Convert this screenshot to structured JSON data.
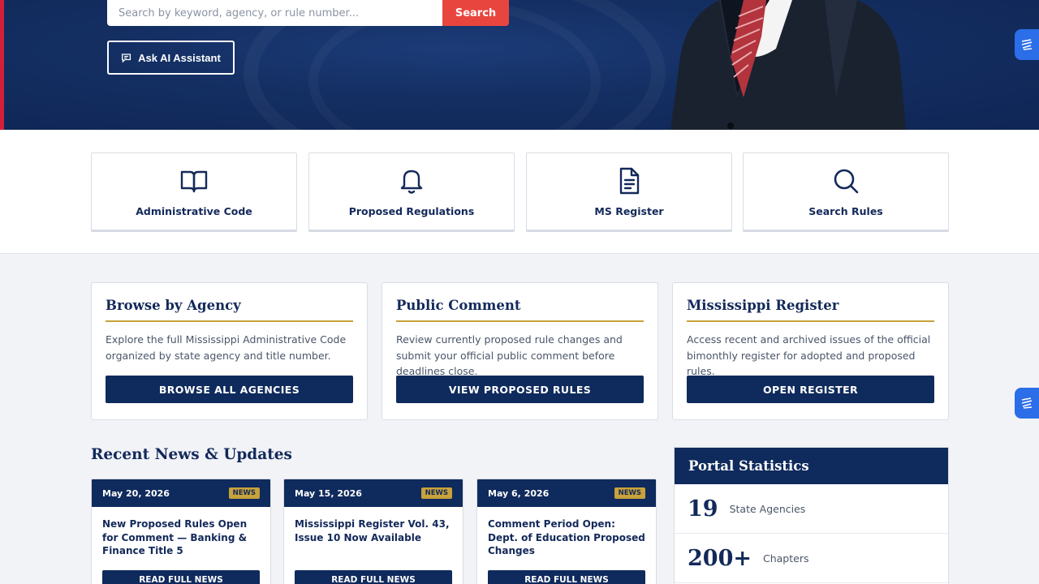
{
  "hero": {
    "search_placeholder": "Search by keyword, agency, or rule number...",
    "search_button": "Search",
    "ai_button": "Ask AI Assistant"
  },
  "quick_links": [
    {
      "label": "Administrative Code",
      "icon": "book-icon"
    },
    {
      "label": "Proposed Regulations",
      "icon": "bell-icon"
    },
    {
      "label": "MS Register",
      "icon": "document-icon"
    },
    {
      "label": "Search Rules",
      "icon": "search-icon"
    }
  ],
  "info_cards": [
    {
      "title": "Browse by Agency",
      "text": "Explore the full Mississippi Administrative Code organized by state agency and title number.",
      "button": "BROWSE ALL AGENCIES"
    },
    {
      "title": "Public Comment",
      "text": "Review currently proposed rule changes and submit your official public comment before deadlines close.",
      "button": "VIEW PROPOSED RULES"
    },
    {
      "title": "Mississippi Register",
      "text": "Access recent and archived issues of the official bimonthly register for adopted and proposed rules.",
      "button": "OPEN REGISTER"
    }
  ],
  "news": {
    "heading": "Recent News & Updates",
    "items": [
      {
        "date": "May 20, 2026",
        "badge": "NEWS",
        "title": "New Proposed Rules Open for Comment — Banking & Finance Title 5",
        "button": "READ FULL NEWS"
      },
      {
        "date": "May 15, 2026",
        "badge": "NEWS",
        "title": "Mississippi Register Vol. 43, Issue 10 Now Available",
        "button": "READ FULL NEWS"
      },
      {
        "date": "May 6, 2026",
        "badge": "NEWS",
        "title": "Comment Period Open: Dept. of Education Proposed Changes",
        "button": "READ FULL NEWS"
      }
    ]
  },
  "stats": {
    "heading": "Portal Statistics",
    "rows": [
      {
        "value": "19",
        "label": "State Agencies"
      },
      {
        "value": "200+",
        "label": "Chapters"
      }
    ]
  },
  "colors": {
    "navy": "#0f2a5c",
    "accent_red": "#e9453f",
    "gold": "#c8a23a",
    "float_blue": "#2b6ee8"
  }
}
